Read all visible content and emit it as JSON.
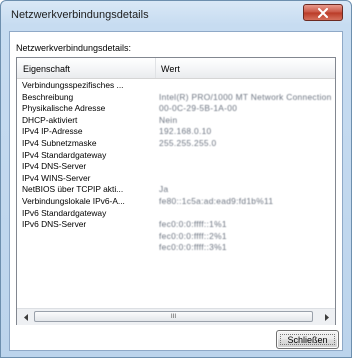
{
  "window": {
    "title": "Netzwerkverbindungsdetails",
    "close_icon": "close-x-icon"
  },
  "section_label": "Netzwerkverbindungsdetails:",
  "table": {
    "columns": [
      "Eigenschaft",
      "Wert"
    ],
    "rows": [
      {
        "property": "Verbindungsspezifisches ...",
        "value": ""
      },
      {
        "property": "Beschreibung",
        "value": "Intel(R) PRO/1000 MT Network Connection"
      },
      {
        "property": "Physikalische Adresse",
        "value": "00-0C-29-5B-1A-00"
      },
      {
        "property": "DHCP-aktiviert",
        "value": "Nein"
      },
      {
        "property": "IPv4 IP-Adresse",
        "value": "192.168.0.10"
      },
      {
        "property": "IPv4 Subnetzmaske",
        "value": "255.255.255.0"
      },
      {
        "property": "IPv4 Standardgateway",
        "value": ""
      },
      {
        "property": "IPv4 DNS-Server",
        "value": ""
      },
      {
        "property": "IPv4 WINS-Server",
        "value": ""
      },
      {
        "property": "NetBIOS über TCPIP akti...",
        "value": "Ja"
      },
      {
        "property": "Verbindungslokale IPv6-A...",
        "value": "fe80::1c5a:ad:ead9:fd1b%11"
      },
      {
        "property": "IPv6 Standardgateway",
        "value": ""
      },
      {
        "property": "IPv6 DNS-Server",
        "value": "fec0:0:0:ffff::1%1"
      },
      {
        "property": "",
        "value": "fec0:0:0:ffff::2%1"
      },
      {
        "property": "",
        "value": "fec0:0:0:ffff::3%1"
      }
    ]
  },
  "scrollbar": {
    "left_icon": "scroll-left-arrow-icon",
    "right_icon": "scroll-right-arrow-icon",
    "grip": "III"
  },
  "buttons": {
    "close_label": "Schließen"
  }
}
